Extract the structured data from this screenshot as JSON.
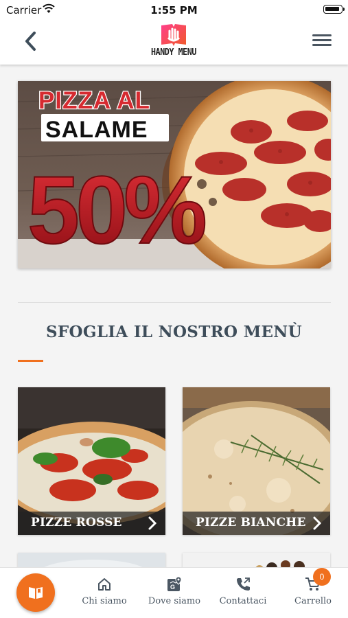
{
  "status_bar": {
    "carrier": "Carrier",
    "time": "1:55 PM"
  },
  "header": {
    "logo_text": "HANDY MENU",
    "back_icon": "chevron-left-icon",
    "menu_icon": "hamburger-icon"
  },
  "promo": {
    "line1": "PIZZA AL",
    "line2": "SALAME",
    "discount": "50%"
  },
  "section": {
    "title": "SFOGLIA IL NOSTRO MENÙ"
  },
  "categories": [
    {
      "label": "PIZZE ROSSE"
    },
    {
      "label": "PIZZE BIANCHE"
    }
  ],
  "tab_bar": {
    "items": [
      {
        "label": "Chi siamo",
        "icon": "home-icon"
      },
      {
        "label": "Dove siamo",
        "icon": "map-pin-icon"
      },
      {
        "label": "Contattaci",
        "icon": "phone-icon"
      },
      {
        "label": "Carrello",
        "icon": "cart-icon"
      }
    ],
    "cart_count": "0",
    "fab_icon": "menu-book-icon"
  },
  "colors": {
    "accent": "#f0701e",
    "title": "#3e4d5a",
    "promo_red": "#c8202a"
  }
}
